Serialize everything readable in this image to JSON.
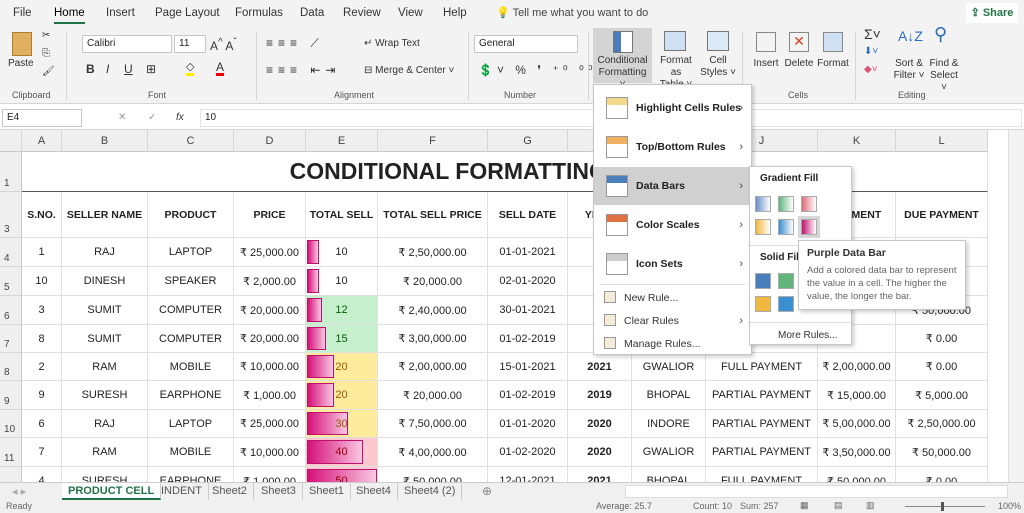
{
  "menu_tabs": [
    "File",
    "Home",
    "Insert",
    "Page Layout",
    "Formulas",
    "Data",
    "Review",
    "View",
    "Help"
  ],
  "active_tab": "Home",
  "tell_me": "Tell me what you want to do",
  "share": "Share",
  "ribbon": {
    "paste": "Paste",
    "clipboard": "Clipboard",
    "font": "Font",
    "font_name": "Calibri",
    "font_size": "11",
    "alignment": "Alignment",
    "wrap_text": "Wrap Text",
    "merge_center": "Merge & Center",
    "number": "Number",
    "number_format": "General",
    "cond_fmt_1": "Conditional",
    "cond_fmt_2": "Formatting",
    "fmt_table_1": "Format as",
    "fmt_table_2": "Table",
    "cell_styles_1": "Cell",
    "cell_styles_2": "Styles",
    "insert": "Insert",
    "delete": "Delete",
    "format": "Format",
    "cells": "Cells",
    "sort_1": "Sort &",
    "sort_2": "Filter",
    "find_1": "Find &",
    "find_2": "Select",
    "editing": "Editing"
  },
  "formula_bar": {
    "name_box": "E4",
    "fx": "fx",
    "value": "10"
  },
  "columns": [
    "A",
    "B",
    "C",
    "D",
    "E",
    "F",
    "G",
    "H",
    "I",
    "J",
    "K",
    "L"
  ],
  "rows": [
    "1",
    "3",
    "4",
    "5",
    "6",
    "7",
    "8",
    "9",
    "10",
    "11",
    "12"
  ],
  "sheet_title": "CONDITIONAL FORMATTING IN EXCEL",
  "headers": [
    "S.NO.",
    "SELLER NAME",
    "PRODUCT",
    "PRICE",
    "TOTAL SELL",
    "TOTAL SELL PRICE",
    "SELL DATE",
    "YEAR",
    "CITY",
    "PAYMENT STATUS",
    "PAYMENT",
    "DUE PAYMENT"
  ],
  "table": [
    [
      "1",
      "RAJ",
      "LAPTOP",
      "₹ 25,000.00",
      "10",
      "₹ 2,50,000.00",
      "01-01-2021",
      "",
      "",
      "",
      "",
      ""
    ],
    [
      "10",
      "DINESH",
      "SPEAKER",
      "₹ 2,000.00",
      "10",
      "₹ 20,000.00",
      "02-01-2020",
      "",
      "",
      "",
      "",
      ""
    ],
    [
      "3",
      "SUMIT",
      "COMPUTER",
      "₹ 20,000.00",
      "12",
      "₹ 2,40,000.00",
      "30-01-2021",
      "",
      "",
      "",
      "",
      "₹ 50,000.00"
    ],
    [
      "8",
      "SUMIT",
      "COMPUTER",
      "₹ 20,000.00",
      "15",
      "₹ 3,00,000.00",
      "01-02-2019",
      "",
      "",
      "",
      "",
      "₹ 0.00"
    ],
    [
      "2",
      "RAM",
      "MOBILE",
      "₹ 10,000.00",
      "20",
      "₹ 2,00,000.00",
      "15-01-2021",
      "2021",
      "GWALIOR",
      "FULL PAYMENT",
      "₹ 2,00,000.00",
      "₹ 0.00"
    ],
    [
      "9",
      "SURESH",
      "EARPHONE",
      "₹ 1,000.00",
      "20",
      "₹ 20,000.00",
      "01-02-2019",
      "2019",
      "BHOPAL",
      "PARTIAL PAYMENT",
      "₹ 15,000.00",
      "₹ 5,000.00"
    ],
    [
      "6",
      "RAJ",
      "LAPTOP",
      "₹ 25,000.00",
      "30",
      "₹ 7,50,000.00",
      "01-01-2020",
      "2020",
      "INDORE",
      "PARTIAL PAYMENT",
      "₹ 5,00,000.00",
      "₹ 2,50,000.00"
    ],
    [
      "7",
      "RAM",
      "MOBILE",
      "₹ 10,000.00",
      "40",
      "₹ 4,00,000.00",
      "01-02-2020",
      "2020",
      "GWALIOR",
      "PARTIAL PAYMENT",
      "₹ 3,50,000.00",
      "₹ 50,000.00"
    ],
    [
      "4",
      "SURESH",
      "EARPHONE",
      "₹ 1,000.00",
      "50",
      "₹ 50,000.00",
      "12-01-2021",
      "2021",
      "BHOPAL",
      "FULL PAYMENT",
      "₹ 50,000.00",
      "₹ 0.00"
    ]
  ],
  "highlight": {
    "green_bg": "#c6efce",
    "green_fg": "#006100",
    "yellow_bg": "#ffeb9c",
    "yellow_fg": "#9c5700",
    "red_bg": "#ffc7ce",
    "red_fg": "#9c0006",
    "bar": "#d6117a"
  },
  "cf_menu": {
    "items": [
      "Highlight Cells Rules",
      "Top/Bottom Rules",
      "Data Bars",
      "Color Scales",
      "Icon Sets"
    ],
    "small": [
      "New Rule...",
      "Clear Rules",
      "Manage Rules..."
    ]
  },
  "submenu": {
    "gradient": "Gradient Fill",
    "solid": "Solid Fill",
    "more": "More Rules..."
  },
  "tooltip": {
    "title": "Purple Data Bar",
    "body": "Add a colored data bar to represent the value in a cell. The higher the value, the longer the bar."
  },
  "sheets": [
    "PRODUCT CELL",
    "INDENT",
    "Sheet2",
    "Sheet3",
    "Sheet1",
    "Sheet4",
    "Sheet4 (2)"
  ],
  "status": {
    "ready": "Ready",
    "average": "Average: 25.7",
    "count": "Count: 10",
    "sum": "Sum: 257",
    "zoom": "100%"
  }
}
